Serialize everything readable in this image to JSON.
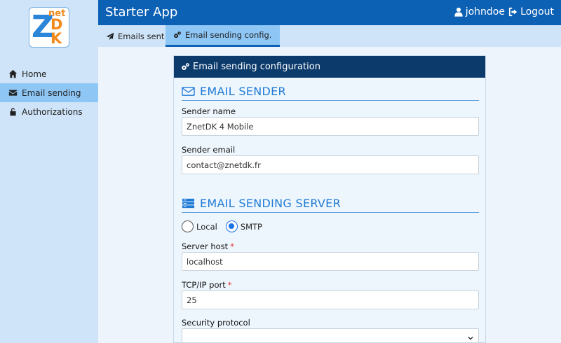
{
  "app": {
    "title": "Starter App"
  },
  "user": {
    "name": "johndoe",
    "logout_label": "Logout"
  },
  "logo": {
    "z": "Z",
    "net": "net",
    "dk": "DK"
  },
  "sidebar": {
    "items": [
      {
        "label": "Home",
        "icon": "home-icon"
      },
      {
        "label": "Email sending",
        "icon": "envelope-icon",
        "active": true
      },
      {
        "label": "Authorizations",
        "icon": "unlock-icon"
      }
    ]
  },
  "tabs": [
    {
      "label": "Emails sent",
      "icon": "paper-plane-icon"
    },
    {
      "label": "Email sending config.",
      "icon": "cogs-icon",
      "active": true
    }
  ],
  "card": {
    "title": "Email sending configuration",
    "sender_section": "EMAIL SENDER",
    "sender_name_label": "Sender name",
    "sender_name_value": "ZnetDK 4 Mobile",
    "sender_email_label": "Sender email",
    "sender_email_value": "contact@znetdk.fr",
    "server_section": "EMAIL SENDING SERVER",
    "radio_local": "Local",
    "radio_smtp": "SMTP",
    "selected_mode": "SMTP",
    "server_host_label": "Server host",
    "server_host_value": "localhost",
    "port_label": "TCP/IP port",
    "port_value": "25",
    "security_label": "Security protocol",
    "security_value": "",
    "required_mark": "*"
  },
  "colors": {
    "header": "#0d61b5",
    "card_header": "#0b3a6b",
    "accent": "#1f7ad6",
    "sidebar": "#cfe4f8"
  }
}
